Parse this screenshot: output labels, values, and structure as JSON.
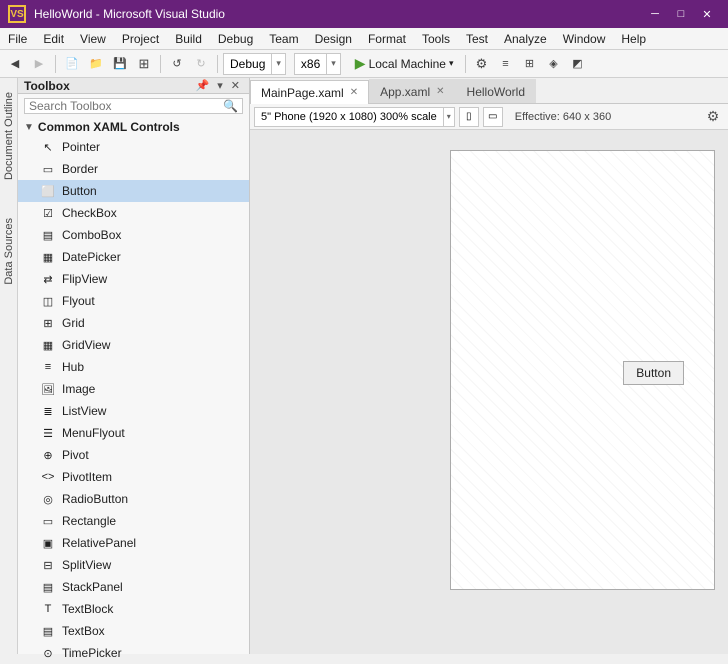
{
  "titlebar": {
    "logo": "VS",
    "title": "HelloWorld - Microsoft Visual Studio",
    "window_controls": [
      "─",
      "□",
      "✕"
    ]
  },
  "menubar": {
    "items": [
      "File",
      "Edit",
      "View",
      "Project",
      "Build",
      "Debug",
      "Team",
      "Design",
      "Format",
      "Tools",
      "Test",
      "Analyze",
      "Window",
      "Help"
    ]
  },
  "toolbar": {
    "debug_config": "Debug",
    "platform": "x86",
    "play_label": "Local Machine",
    "search_label": "Search Toolbox"
  },
  "side_labels": [
    "Document Outline",
    "Data Sources"
  ],
  "toolbox": {
    "title": "Toolbox",
    "search_placeholder": "Search Toolbox",
    "category": "Common XAML Controls",
    "items": [
      {
        "label": "Pointer",
        "icon": "↖"
      },
      {
        "label": "Border",
        "icon": "▭"
      },
      {
        "label": "Button",
        "icon": "⬜",
        "selected": true
      },
      {
        "label": "CheckBox",
        "icon": "☑"
      },
      {
        "label": "ComboBox",
        "icon": "▾"
      },
      {
        "label": "DatePicker",
        "icon": "📅"
      },
      {
        "label": "FlipView",
        "icon": "⇄"
      },
      {
        "label": "Flyout",
        "icon": "💬"
      },
      {
        "label": "Grid",
        "icon": "⊞"
      },
      {
        "label": "GridView",
        "icon": "▦"
      },
      {
        "label": "Hub",
        "icon": "≡"
      },
      {
        "label": "Image",
        "icon": "🖼"
      },
      {
        "label": "ListView",
        "icon": "≣"
      },
      {
        "label": "MenuFlyout",
        "icon": "☰"
      },
      {
        "label": "Pivot",
        "icon": "⇕"
      },
      {
        "label": "PivotItem",
        "icon": "<>"
      },
      {
        "label": "RadioButton",
        "icon": "◎"
      },
      {
        "label": "Rectangle",
        "icon": "▭"
      },
      {
        "label": "RelativePanel",
        "icon": "▣"
      },
      {
        "label": "SplitView",
        "icon": "⊟"
      },
      {
        "label": "StackPanel",
        "icon": "▤"
      },
      {
        "label": "TextBlock",
        "icon": "T"
      },
      {
        "label": "TextBox",
        "icon": "⌨"
      },
      {
        "label": "TimePicker",
        "icon": "🕐"
      }
    ]
  },
  "tabs": [
    {
      "label": "MainPage.xaml",
      "active": true,
      "modified": false
    },
    {
      "label": "App.xaml",
      "active": false
    },
    {
      "label": "HelloWorld",
      "active": false
    }
  ],
  "design_toolbar": {
    "device": "5\" Phone (1920 x 1080) 300% scale",
    "effective": "Effective: 640 x 360"
  },
  "canvas": {
    "button_label": "Button"
  }
}
